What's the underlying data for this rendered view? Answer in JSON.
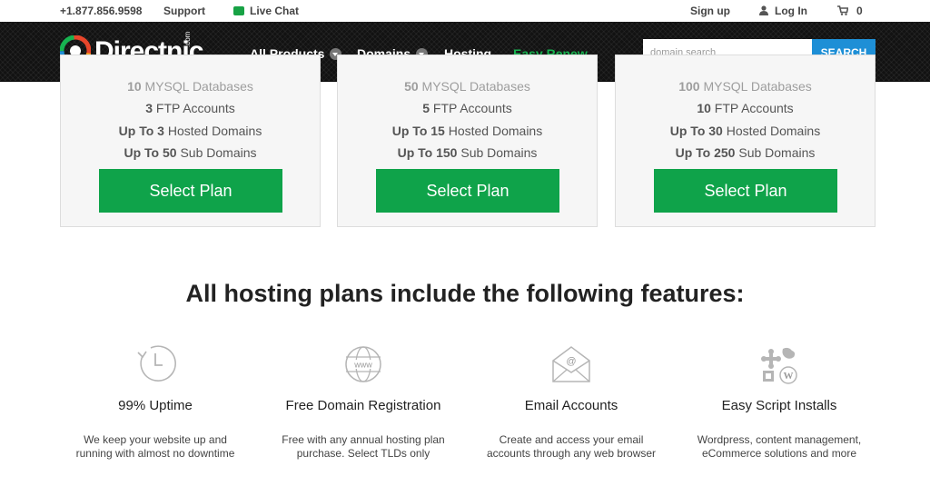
{
  "topbar": {
    "phone": "+1.877.856.9598",
    "support": "Support",
    "live_chat": "Live Chat",
    "sign_up": "Sign up",
    "log_in": "Log In",
    "cart_count": "0"
  },
  "nav": {
    "logo_text": "Directnic",
    "logo_com": ".com",
    "all_products": "All Products",
    "domains": "Domains",
    "hosting": "Hosting",
    "easy_renew": "Easy Renew",
    "search_placeholder": "domain search",
    "search_button": "SEARCH"
  },
  "plans": [
    {
      "mysql_num": "10",
      "mysql_text": " MYSQL Databases",
      "ftp_num": "3",
      "ftp_text": " FTP Accounts",
      "hosted_pre": "Up To ",
      "hosted_num": "3",
      "hosted_text": " Hosted Domains",
      "sub_pre": "Up To ",
      "sub_num": "50",
      "sub_text": " Sub Domains",
      "button": "Select Plan"
    },
    {
      "mysql_num": "50",
      "mysql_text": " MYSQL Databases",
      "ftp_num": "5",
      "ftp_text": " FTP Accounts",
      "hosted_pre": "Up To ",
      "hosted_num": "15",
      "hosted_text": " Hosted Domains",
      "sub_pre": "Up To ",
      "sub_num": "150",
      "sub_text": " Sub Domains",
      "button": "Select Plan"
    },
    {
      "mysql_num": "100",
      "mysql_text": " MYSQL Databases",
      "ftp_num": "10",
      "ftp_text": " FTP Accounts",
      "hosted_pre": "Up To ",
      "hosted_num": "30",
      "hosted_text": " Hosted Domains",
      "sub_pre": "Up To ",
      "sub_num": "250",
      "sub_text": " Sub Domains",
      "button": "Select Plan"
    }
  ],
  "features": {
    "title": "All hosting plans include the following features:",
    "items": [
      {
        "icon": "clock-icon",
        "title": "99% Uptime",
        "desc": "We keep your website up and running with almost no downtime"
      },
      {
        "icon": "globe-www-icon",
        "title": "Free Domain Registration",
        "desc": "Free with any annual hosting plan purchase. Select TLDs only"
      },
      {
        "icon": "envelope-at-icon",
        "title": "Email Accounts",
        "desc": "Create and access your email accounts through any web browser"
      },
      {
        "icon": "cms-logos-icon",
        "title": "Easy Script Installs",
        "desc": "Wordpress, content management, eCommerce solutions and more"
      }
    ]
  },
  "colors": {
    "brand_green": "#0fa34a",
    "nav_green": "#17b350",
    "search_blue": "#1e8fd6",
    "nav_bg": "#121212"
  }
}
